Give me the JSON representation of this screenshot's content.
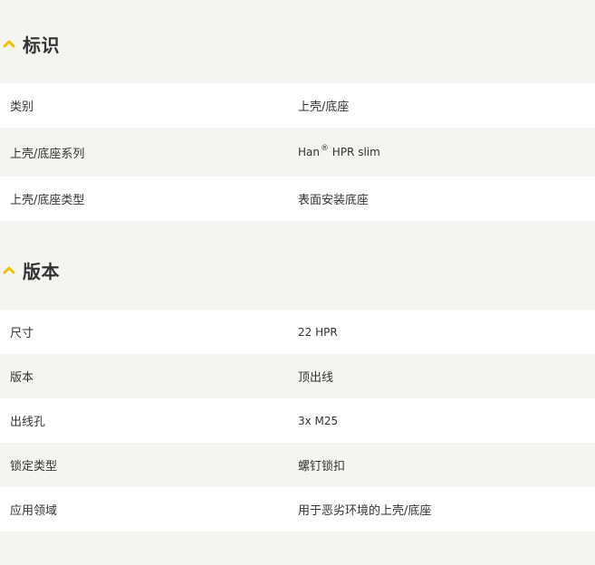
{
  "sections": [
    {
      "title": "标识",
      "icon": "chevron-up-icon",
      "rows": [
        {
          "label": "类别",
          "value": "上壳/底座"
        },
        {
          "label": "上壳/底座系列",
          "value": "Han",
          "value_sup": "®",
          "value_suffix": " HPR slim"
        },
        {
          "label": "上壳/底座类型",
          "value": "表面安装底座"
        }
      ]
    },
    {
      "title": "版本",
      "icon": "chevron-up-icon",
      "rows": [
        {
          "label": "尺寸",
          "value": "22 HPR"
        },
        {
          "label": "版本",
          "value": "顶出线"
        },
        {
          "label": "出线孔",
          "value": "3x M25"
        },
        {
          "label": "锁定类型",
          "value": "螺钉锁扣"
        },
        {
          "label": "应用领域",
          "value": "用于恶劣环境的上壳/底座"
        }
      ]
    }
  ],
  "colors": {
    "accent": "#f2c100",
    "page_bg": "#f5f4f1",
    "row_white": "#ffffff",
    "text": "#333333"
  }
}
